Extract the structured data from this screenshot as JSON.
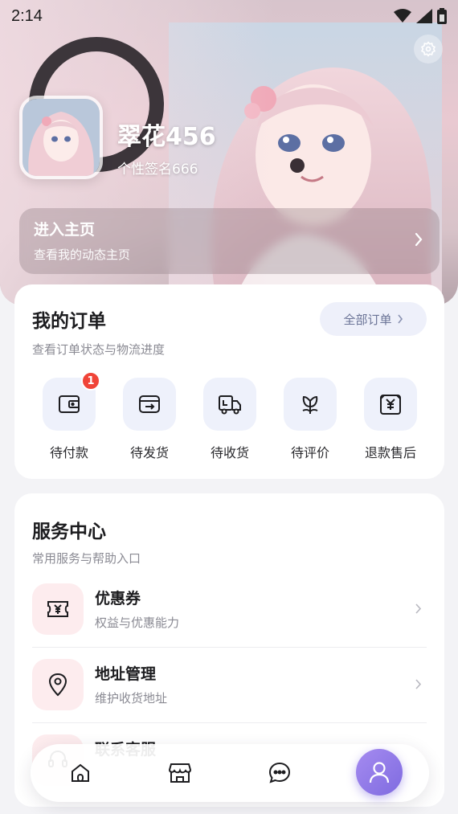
{
  "status_bar": {
    "time": "2:14"
  },
  "profile": {
    "username": "翠花456",
    "signature": "个性签名666"
  },
  "home_entry": {
    "title": "进入主页",
    "subtitle": "查看我的动态主页"
  },
  "orders": {
    "title": "我的订单",
    "subtitle": "查看订单状态与物流进度",
    "all_label": "全部订单",
    "items": [
      {
        "label": "待付款",
        "icon": "wallet-icon",
        "badge": "1"
      },
      {
        "label": "待发货",
        "icon": "send-box-icon"
      },
      {
        "label": "待收货",
        "icon": "delivery-truck-icon"
      },
      {
        "label": "待评价",
        "icon": "flower-icon"
      },
      {
        "label": "退款售后",
        "icon": "refund-yen-icon"
      }
    ]
  },
  "services": {
    "title": "服务中心",
    "subtitle": "常用服务与帮助入口",
    "items": [
      {
        "title": "优惠券",
        "subtitle": "权益与优惠能力",
        "icon": "coupon-icon"
      },
      {
        "title": "地址管理",
        "subtitle": "维护收货地址",
        "icon": "location-pin-icon"
      },
      {
        "title": "联系客服",
        "subtitle": "",
        "icon": "service-icon"
      }
    ]
  },
  "bottom_nav": {
    "items": [
      "home-icon",
      "store-icon",
      "chat-icon",
      "profile-icon"
    ],
    "active": "profile-icon"
  },
  "colors": {
    "accent": "#8b74e6",
    "badge": "#f04438",
    "order_icon_bg": "#eef1fb",
    "service_icon_bg": "#fdecee"
  }
}
